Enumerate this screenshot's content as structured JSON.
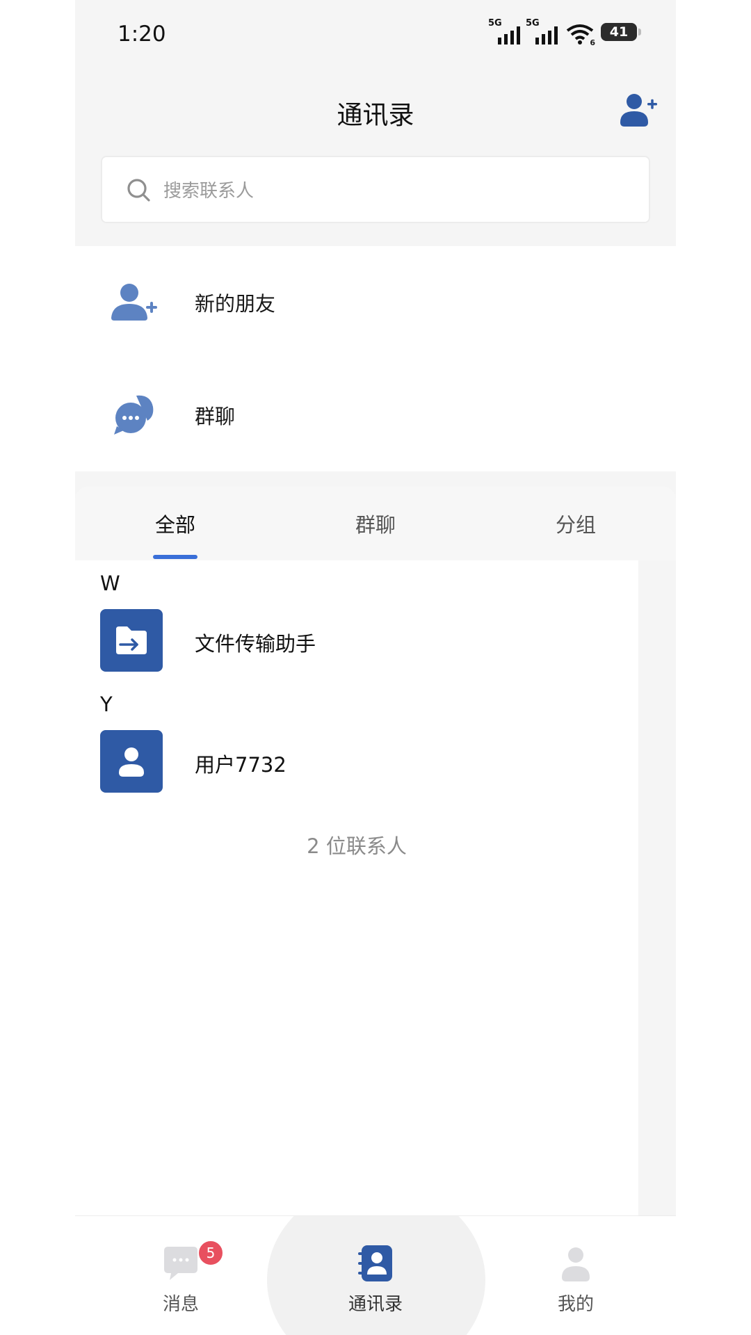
{
  "status_bar": {
    "time": "1:20",
    "sim1_label": "5G",
    "sim2_label": "5G",
    "wifi_label": "6",
    "battery": "41"
  },
  "header": {
    "title": "通讯录",
    "add_icon": "add-contact-icon"
  },
  "search": {
    "placeholder": "搜索联系人"
  },
  "quick_actions": [
    {
      "label": "新的朋友",
      "icon": "new-friend-icon"
    },
    {
      "label": "群聊",
      "icon": "group-chat-icon"
    }
  ],
  "tabs": [
    {
      "label": "全部",
      "active": true
    },
    {
      "label": "群聊",
      "active": false
    },
    {
      "label": "分组",
      "active": false
    }
  ],
  "contact_sections": [
    {
      "letter": "W",
      "contacts": [
        {
          "name": "文件传输助手",
          "icon": "file-transfer-icon"
        }
      ]
    },
    {
      "letter": "Y",
      "contacts": [
        {
          "name": "用户7732",
          "icon": "user-avatar-icon"
        }
      ]
    }
  ],
  "contact_count": "2 位联系人",
  "bottom_nav": [
    {
      "label": "消息",
      "icon": "chat-icon",
      "badge": "5",
      "active": false
    },
    {
      "label": "通讯录",
      "icon": "contacts-book-icon",
      "active": true
    },
    {
      "label": "我的",
      "icon": "profile-icon",
      "active": false
    }
  ],
  "colors": {
    "accent": "#2f5aa5",
    "tab_indicator": "#3a6fd8",
    "badge": "#e8505f",
    "page_bg": "#f5f5f5"
  }
}
